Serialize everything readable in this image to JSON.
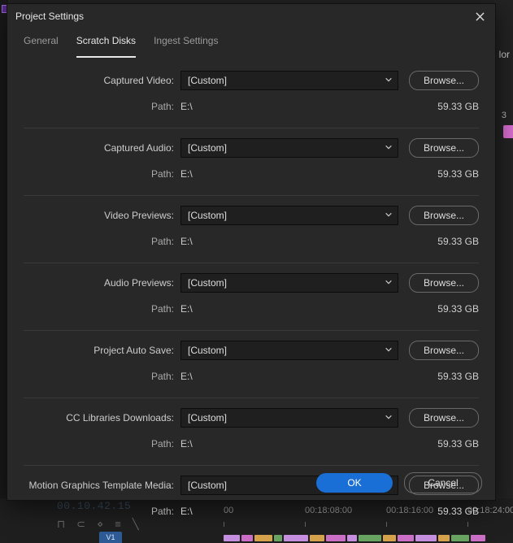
{
  "background": {
    "color_label": "lor",
    "badge_3": "3",
    "timeline_tc": "00.10.42.15",
    "track_button": "V1",
    "ruler": [
      "00",
      "00:18:08:00",
      "00:18:16:00",
      "00:18:24:00"
    ]
  },
  "dialog": {
    "title": "Project Settings",
    "tabs": [
      {
        "label": "General",
        "active": false
      },
      {
        "label": "Scratch Disks",
        "active": true
      },
      {
        "label": "Ingest Settings",
        "active": false
      }
    ],
    "path_label": "Path:",
    "browse_label": "Browse...",
    "groups": [
      {
        "label": "Captured Video:",
        "value": "[Custom]",
        "path": "E:\\",
        "size": "59.33 GB"
      },
      {
        "label": "Captured Audio:",
        "value": "[Custom]",
        "path": "E:\\",
        "size": "59.33 GB"
      },
      {
        "label": "Video Previews:",
        "value": "[Custom]",
        "path": "E:\\",
        "size": "59.33 GB"
      },
      {
        "label": "Audio Previews:",
        "value": "[Custom]",
        "path": "E:\\",
        "size": "59.33 GB"
      },
      {
        "label": "Project Auto Save:",
        "value": "[Custom]",
        "path": "E:\\",
        "size": "59.33 GB"
      },
      {
        "label": "CC Libraries Downloads:",
        "value": "[Custom]",
        "path": "E:\\",
        "size": "59.33 GB"
      },
      {
        "label": "Motion Graphics Template Media:",
        "value": "[Custom]",
        "path": "E:\\",
        "size": "59.33 GB"
      }
    ],
    "footer": {
      "ok": "OK",
      "cancel": "Cancel"
    }
  }
}
